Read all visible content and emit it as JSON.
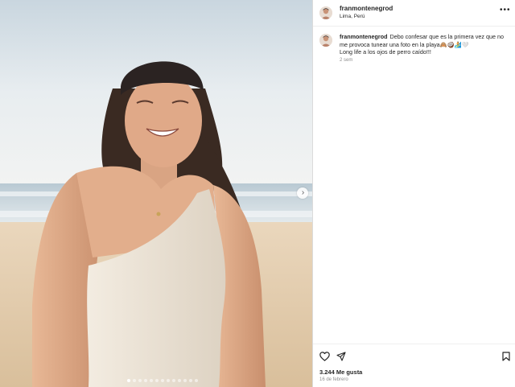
{
  "post": {
    "username": "franmontenegrod",
    "location": "Lima, Perú",
    "more_icon": "more-horizontal-icon"
  },
  "caption": {
    "username": "franmontenegrod",
    "text_line1": "Debo confesar que es la primera vez que no me provoca tunear una foto en la playa🙈🥥🏄🤍",
    "text_line2": "Long life a los ojos de perro caído!!!",
    "time": "2 sem"
  },
  "media": {
    "image_icon": "photo-woman-beach",
    "next_icon": "chevron-right-icon",
    "dot_count": 13,
    "active_dot": 1
  },
  "actions": {
    "like_icon": "heart-icon",
    "share_icon": "send-icon",
    "save_icon": "bookmark-icon"
  },
  "likes": "3.244 Me gusta",
  "date": "16 de febrero"
}
